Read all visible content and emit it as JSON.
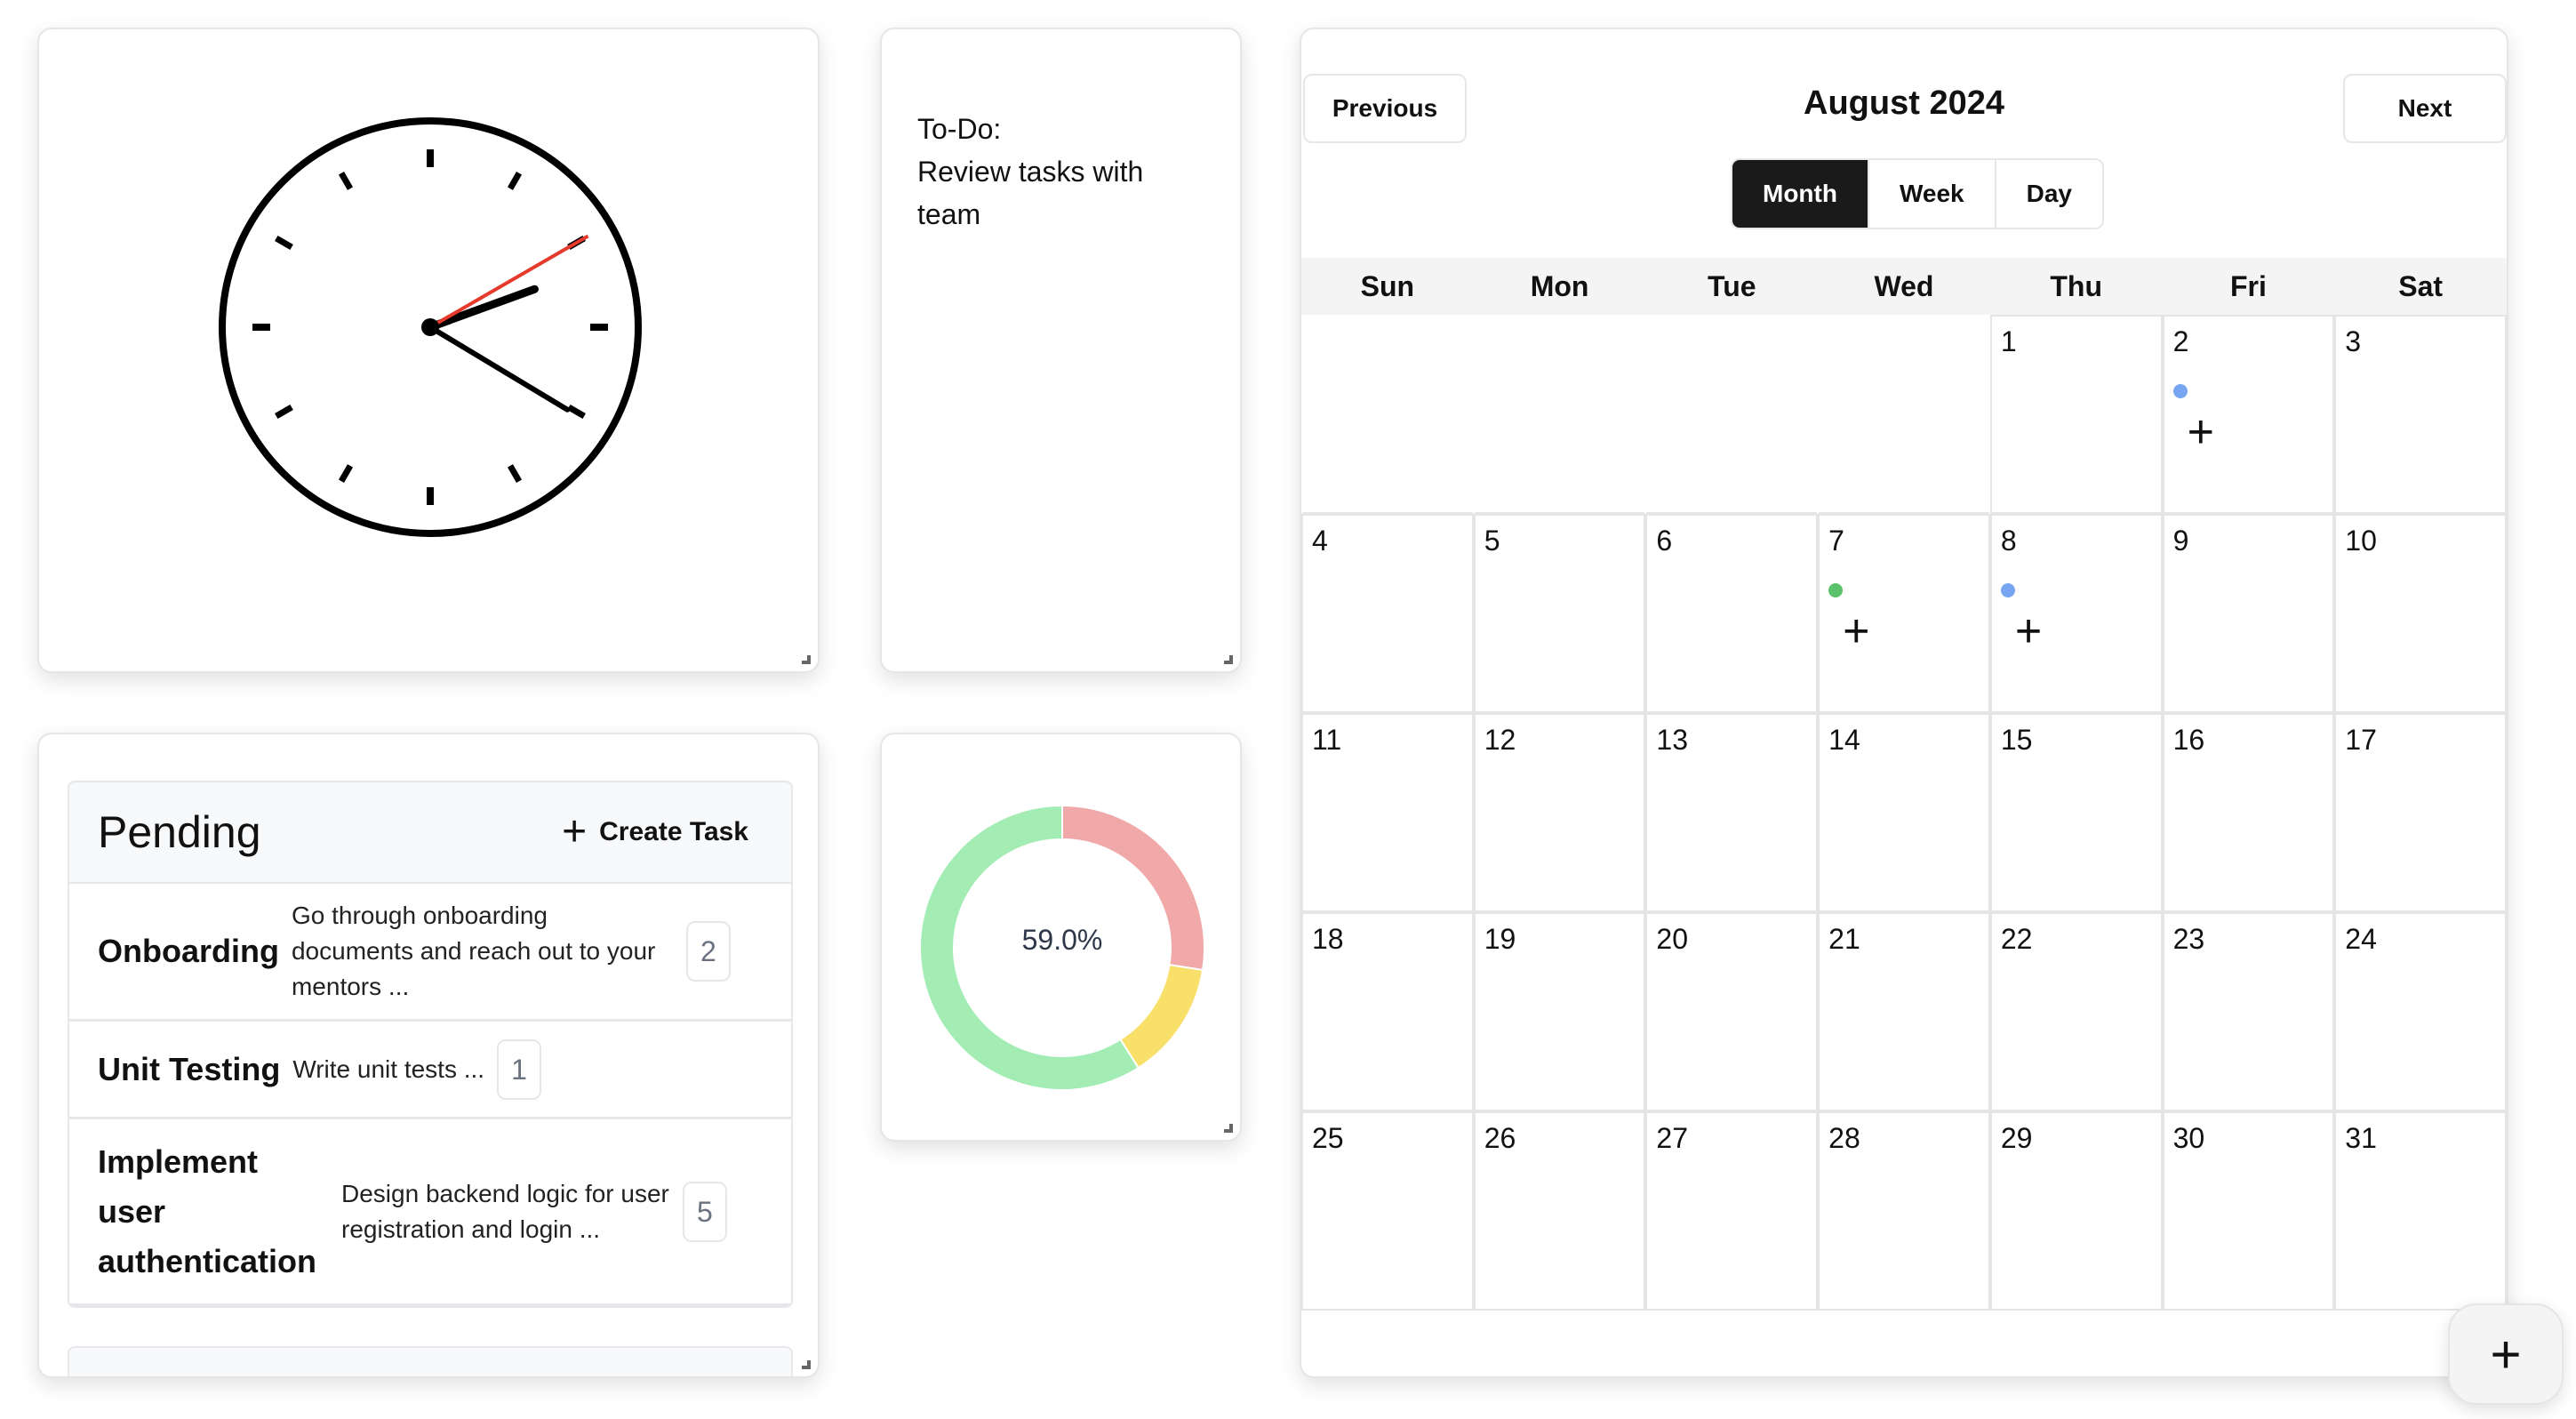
{
  "clock": {
    "hours": 2,
    "minutes": 20,
    "seconds": 10
  },
  "todo": {
    "text": "To-Do:\nReview tasks with\nteam"
  },
  "tasks": {
    "column_title": "Pending",
    "create_label": "Create Task",
    "items": [
      {
        "name": "Onboarding",
        "description": "Go through onboarding documents and reach out to your mentors ...",
        "count": "2"
      },
      {
        "name": "Unit Testing",
        "description": "Write unit tests ...",
        "count": "1"
      },
      {
        "name": "Implement user authentication",
        "description": "Design backend logic for user registration and login ...",
        "count": "5"
      }
    ]
  },
  "chart_data": {
    "type": "pie",
    "title": "",
    "center_label": "59.0%",
    "slices": [
      {
        "label": "red",
        "value": 27.5,
        "color": "#f0a8a8"
      },
      {
        "label": "yellow",
        "value": 13.5,
        "color": "#f8e06a"
      },
      {
        "label": "green",
        "value": 59.0,
        "color": "#a3edb5"
      }
    ]
  },
  "calendar": {
    "title": "August 2024",
    "prev_label": "Previous",
    "next_label": "Next",
    "views": [
      "Month",
      "Week",
      "Day"
    ],
    "active_view": "Month",
    "weekdays": [
      "Sun",
      "Mon",
      "Tue",
      "Wed",
      "Thu",
      "Fri",
      "Sat"
    ],
    "first_weekday_index": 4,
    "days_in_month": 31,
    "events": {
      "2": "#76a6f2",
      "7": "#5cc26c",
      "8": "#76a6f2"
    }
  },
  "fab": {
    "icon": "plus-icon"
  }
}
